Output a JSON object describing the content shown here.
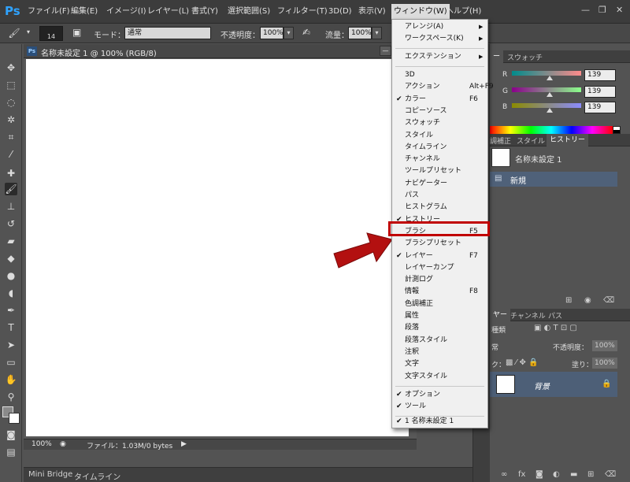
{
  "app": {
    "logo": "Ps"
  },
  "menubar": {
    "items": [
      {
        "label": "ファイル(F)"
      },
      {
        "label": "編集(E)"
      },
      {
        "label": "イメージ(I)"
      },
      {
        "label": "レイヤー(L)"
      },
      {
        "label": "書式(Y)"
      },
      {
        "label": "選択範囲(S)"
      },
      {
        "label": "フィルター(T)"
      },
      {
        "label": "3D(D)"
      },
      {
        "label": "表示(V)"
      },
      {
        "label": "ウィンドウ(W)"
      },
      {
        "label": "ヘルプ(H)"
      }
    ],
    "active_index": 9
  },
  "window_controls": {
    "minimize": "—",
    "restore": "❐",
    "close": "✕"
  },
  "options": {
    "brush_size": "14",
    "mode_label": "モード：",
    "mode_value": "通常",
    "opacity_label": "不透明度：",
    "opacity_value": "100%",
    "flow_label": "流量：",
    "flow_value": "100%"
  },
  "document": {
    "title": "名称未設定 1 @ 100% (RGB/8)",
    "zoom": "100%",
    "file_info": "ファイル：1.03M/0 bytes"
  },
  "bottom_tabs": [
    "Mini Bridge",
    "タイムライン"
  ],
  "color_panel": {
    "tabs": [
      "ー",
      "スウォッチ"
    ],
    "r_label": "R",
    "g_label": "G",
    "b_label": "B",
    "r_value": "139",
    "g_value": "139",
    "b_value": "139",
    "level": 0.545
  },
  "history_panel": {
    "tabs": [
      "調補正",
      "スタイル",
      "ヒストリー"
    ],
    "snapshot": "名称未設定 1",
    "state": "新規"
  },
  "layers_panel": {
    "tabs": [
      "ヤー",
      "チャンネル",
      "パス"
    ],
    "kind_label": "種類",
    "blend": "常",
    "opacity_label": "不透明度：",
    "opacity_value": "100%",
    "lock_label": "ク：",
    "fill_label": "塗り：",
    "fill_value": "100%",
    "layer_name": "背景"
  },
  "window_menu": {
    "top": [
      {
        "label": "アレンジ(A)",
        "submenu": "▶"
      },
      {
        "label": "ワークスペース(K)",
        "submenu": "▶"
      }
    ],
    "ext": [
      {
        "label": "エクステンション",
        "submenu": "▶"
      }
    ],
    "panels": [
      {
        "label": "3D",
        "check": "",
        "shortcut": ""
      },
      {
        "label": "アクション",
        "check": "",
        "shortcut": "Alt+F9"
      },
      {
        "label": "カラー",
        "check": "✔",
        "shortcut": "F6"
      },
      {
        "label": "コピーソース",
        "check": "",
        "shortcut": ""
      },
      {
        "label": "スウォッチ",
        "check": "",
        "shortcut": ""
      },
      {
        "label": "スタイル",
        "check": "",
        "shortcut": ""
      },
      {
        "label": "タイムライン",
        "check": "",
        "shortcut": ""
      },
      {
        "label": "チャンネル",
        "check": "",
        "shortcut": ""
      },
      {
        "label": "ツールプリセット",
        "check": "",
        "shortcut": ""
      },
      {
        "label": "ナビゲーター",
        "check": "",
        "shortcut": ""
      },
      {
        "label": "パス",
        "check": "",
        "shortcut": ""
      },
      {
        "label": "ヒストグラム",
        "check": "",
        "shortcut": ""
      },
      {
        "label": "ヒストリー",
        "check": "✔",
        "shortcut": ""
      },
      {
        "label": "ブラシ",
        "check": "",
        "shortcut": "F5"
      },
      {
        "label": "ブラシプリセット",
        "check": "",
        "shortcut": ""
      },
      {
        "label": "レイヤー",
        "check": "✔",
        "shortcut": "F7"
      },
      {
        "label": "レイヤーカンプ",
        "check": "",
        "shortcut": ""
      },
      {
        "label": "計測ログ",
        "check": "",
        "shortcut": ""
      },
      {
        "label": "情報",
        "check": "",
        "shortcut": "F8"
      },
      {
        "label": "色調補正",
        "check": "",
        "shortcut": ""
      },
      {
        "label": "属性",
        "check": "",
        "shortcut": ""
      },
      {
        "label": "段落",
        "check": "",
        "shortcut": ""
      },
      {
        "label": "段落スタイル",
        "check": "",
        "shortcut": ""
      },
      {
        "label": "注釈",
        "check": "",
        "shortcut": ""
      },
      {
        "label": "文字",
        "check": "",
        "shortcut": ""
      },
      {
        "label": "文字スタイル",
        "check": "",
        "shortcut": ""
      }
    ],
    "toggles": [
      {
        "label": "オプション",
        "check": "✔"
      },
      {
        "label": "ツール",
        "check": "✔"
      }
    ],
    "docs": [
      {
        "label": "1 名称未設定 1",
        "check": "✔"
      }
    ],
    "highlighted": "ブラシ"
  },
  "colors": {
    "accent": "#2fa3ff",
    "highlight": "#c00000",
    "selection": "#4f6179"
  }
}
